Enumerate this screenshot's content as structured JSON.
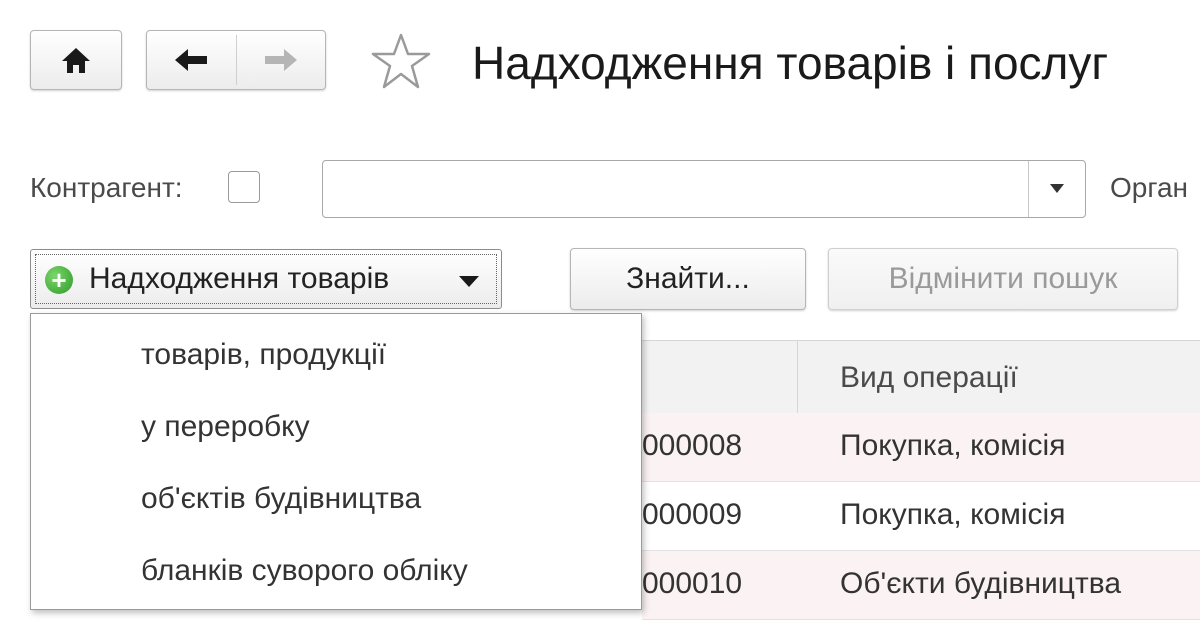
{
  "header": {
    "title": "Надходження товарів і послуг",
    "home_icon": "home-icon",
    "back_icon": "arrow-left-icon",
    "forward_icon": "arrow-right-icon",
    "favorite_icon": "star-icon"
  },
  "filter": {
    "counterparty_label": "Контрагент:",
    "counterparty_value": "",
    "organization_label_partial": "Орган"
  },
  "toolbar": {
    "create_button_label": "Надходження товарів",
    "find_button_label": "Знайти...",
    "cancel_search_label": "Відмінити пошук"
  },
  "dropdown_menu": {
    "items": [
      "товарів, продукції",
      "у переробку",
      "об'єктів будівництва",
      "бланків суворого обліку"
    ]
  },
  "table": {
    "columns": [
      "",
      "Вид операції"
    ],
    "rows": [
      {
        "number": "000008",
        "operation": "Покупка, комісія"
      },
      {
        "number": "000009",
        "operation": "Покупка, комісія"
      },
      {
        "number": "000010",
        "operation": "Об'єкти будівництва"
      }
    ]
  },
  "colors": {
    "accent_green": "#2f9a28",
    "row_alt": "#fbf3f3"
  }
}
